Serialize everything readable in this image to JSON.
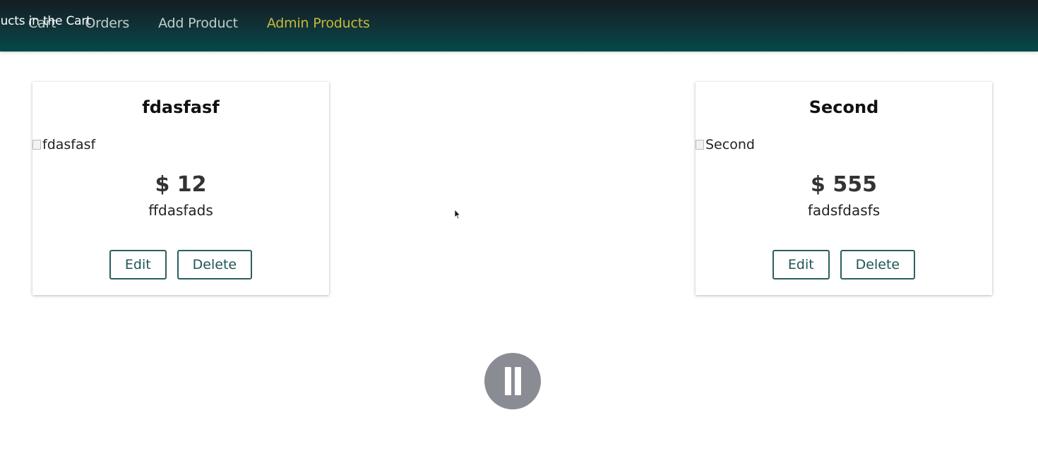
{
  "header": {
    "nav": [
      {
        "label": "Cart",
        "active": false
      },
      {
        "label": "Orders",
        "active": false
      },
      {
        "label": "Add Product",
        "active": false
      },
      {
        "label": "Admin Products",
        "active": true
      }
    ],
    "tooltip": "ducts in the Cart",
    "colors": {
      "nav_text": "#c3cdcc",
      "active": "#c9b935",
      "gradient_top": "#141d24",
      "gradient_bottom": "#03494a"
    }
  },
  "products": [
    {
      "title": "fdasfasf",
      "image_alt": "fdasfasf",
      "price": "$ 12",
      "description": "ffdasfads",
      "edit_label": "Edit",
      "delete_label": "Delete"
    },
    {
      "title": "Second",
      "image_alt": "Second",
      "price": "$ 555",
      "description": "fadsfdasfs",
      "edit_label": "Edit",
      "delete_label": "Delete"
    }
  ],
  "overlay": {
    "pause_icon": "pause-icon",
    "cursor_icon": "mouse-pointer-icon"
  }
}
